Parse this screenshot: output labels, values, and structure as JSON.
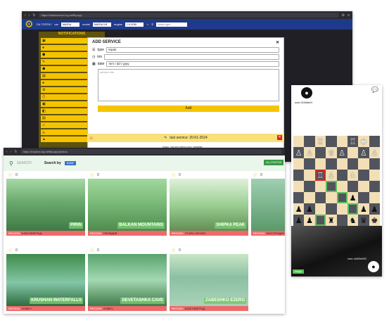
{
  "window1": {
    "url": "https://autoservice-log.netlify.app",
    "app_name": "CA.TOSTA?",
    "filters": [
      {
        "label": "car",
        "value": "MAZDA"
      },
      {
        "label": "model",
        "value": "MAZDA 3 B"
      },
      {
        "label": "engine",
        "value": "1.6 CRDI"
      }
    ],
    "search_placeholder": "search type",
    "sidebar_title": "NOTIFICATIONS",
    "sidebar_count": 15,
    "modal": {
      "title": "ADD SERVICE",
      "type_label": "type",
      "type_value": "repair",
      "km_label": "km",
      "date_label": "date",
      "date_placeholder": "mm / dd / yyyy",
      "notes_placeholder": "service info",
      "add_label": "Add"
    },
    "last_service": "last service: 20-01-2024",
    "next_row": "date: 20-02-2024     km: 50000"
  },
  "window2": {
    "url": "https://explore-bg.netlify.app/photos",
    "search_label": "SEARCH",
    "search_by_label": "Search by",
    "search_by_value": "NAME",
    "all_photos_label": "ALL PHOTOS",
    "region_prefix": "REGION:",
    "cards": [
      {
        "name": "PIRIN",
        "region": "БЛАГОЕВГРАД",
        "count": "0"
      },
      {
        "name": "BALKAN MOUNTAINS",
        "region": "ПЛОВДИВ",
        "count": "0"
      },
      {
        "name": "SHIPKA PEAK",
        "region": "СТАРА ЗАГОРА",
        "count": "0"
      },
      {
        "name": "SEV",
        "region": "КЮСТЕНДИЛ",
        "count": "0"
      },
      {
        "name": "KRUSHAN WATERFALLS",
        "region": "ЛОВЕЧ",
        "count": "0"
      },
      {
        "name": "DEVETASHKA CAVE",
        "region": "ЛОВЕЧ",
        "count": "0"
      },
      {
        "name": "ZABESHKO EZERO",
        "region": "БЛАГОЕВГРАД",
        "count": "0"
      }
    ]
  },
  "window3": {
    "top_user": "user-52fddebf",
    "bottom_user": "user-dd53e892",
    "resign_label": "resign"
  }
}
